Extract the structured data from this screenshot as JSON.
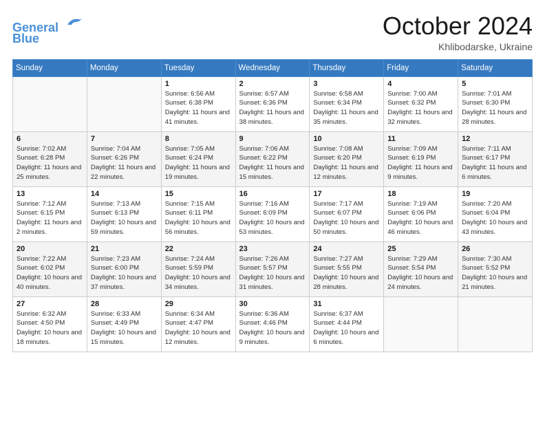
{
  "header": {
    "logo_line1": "General",
    "logo_line2": "Blue",
    "month": "October 2024",
    "location": "Khlibodarske, Ukraine"
  },
  "days_of_week": [
    "Sunday",
    "Monday",
    "Tuesday",
    "Wednesday",
    "Thursday",
    "Friday",
    "Saturday"
  ],
  "weeks": [
    [
      {
        "day": "",
        "info": ""
      },
      {
        "day": "",
        "info": ""
      },
      {
        "day": "1",
        "info": "Sunrise: 6:56 AM\nSunset: 6:38 PM\nDaylight: 11 hours and 41 minutes."
      },
      {
        "day": "2",
        "info": "Sunrise: 6:57 AM\nSunset: 6:36 PM\nDaylight: 11 hours and 38 minutes."
      },
      {
        "day": "3",
        "info": "Sunrise: 6:58 AM\nSunset: 6:34 PM\nDaylight: 11 hours and 35 minutes."
      },
      {
        "day": "4",
        "info": "Sunrise: 7:00 AM\nSunset: 6:32 PM\nDaylight: 11 hours and 32 minutes."
      },
      {
        "day": "5",
        "info": "Sunrise: 7:01 AM\nSunset: 6:30 PM\nDaylight: 11 hours and 28 minutes."
      }
    ],
    [
      {
        "day": "6",
        "info": "Sunrise: 7:02 AM\nSunset: 6:28 PM\nDaylight: 11 hours and 25 minutes."
      },
      {
        "day": "7",
        "info": "Sunrise: 7:04 AM\nSunset: 6:26 PM\nDaylight: 11 hours and 22 minutes."
      },
      {
        "day": "8",
        "info": "Sunrise: 7:05 AM\nSunset: 6:24 PM\nDaylight: 11 hours and 19 minutes."
      },
      {
        "day": "9",
        "info": "Sunrise: 7:06 AM\nSunset: 6:22 PM\nDaylight: 11 hours and 15 minutes."
      },
      {
        "day": "10",
        "info": "Sunrise: 7:08 AM\nSunset: 6:20 PM\nDaylight: 11 hours and 12 minutes."
      },
      {
        "day": "11",
        "info": "Sunrise: 7:09 AM\nSunset: 6:19 PM\nDaylight: 11 hours and 9 minutes."
      },
      {
        "day": "12",
        "info": "Sunrise: 7:11 AM\nSunset: 6:17 PM\nDaylight: 11 hours and 6 minutes."
      }
    ],
    [
      {
        "day": "13",
        "info": "Sunrise: 7:12 AM\nSunset: 6:15 PM\nDaylight: 11 hours and 2 minutes."
      },
      {
        "day": "14",
        "info": "Sunrise: 7:13 AM\nSunset: 6:13 PM\nDaylight: 10 hours and 59 minutes."
      },
      {
        "day": "15",
        "info": "Sunrise: 7:15 AM\nSunset: 6:11 PM\nDaylight: 10 hours and 56 minutes."
      },
      {
        "day": "16",
        "info": "Sunrise: 7:16 AM\nSunset: 6:09 PM\nDaylight: 10 hours and 53 minutes."
      },
      {
        "day": "17",
        "info": "Sunrise: 7:17 AM\nSunset: 6:07 PM\nDaylight: 10 hours and 50 minutes."
      },
      {
        "day": "18",
        "info": "Sunrise: 7:19 AM\nSunset: 6:06 PM\nDaylight: 10 hours and 46 minutes."
      },
      {
        "day": "19",
        "info": "Sunrise: 7:20 AM\nSunset: 6:04 PM\nDaylight: 10 hours and 43 minutes."
      }
    ],
    [
      {
        "day": "20",
        "info": "Sunrise: 7:22 AM\nSunset: 6:02 PM\nDaylight: 10 hours and 40 minutes."
      },
      {
        "day": "21",
        "info": "Sunrise: 7:23 AM\nSunset: 6:00 PM\nDaylight: 10 hours and 37 minutes."
      },
      {
        "day": "22",
        "info": "Sunrise: 7:24 AM\nSunset: 5:59 PM\nDaylight: 10 hours and 34 minutes."
      },
      {
        "day": "23",
        "info": "Sunrise: 7:26 AM\nSunset: 5:57 PM\nDaylight: 10 hours and 31 minutes."
      },
      {
        "day": "24",
        "info": "Sunrise: 7:27 AM\nSunset: 5:55 PM\nDaylight: 10 hours and 28 minutes."
      },
      {
        "day": "25",
        "info": "Sunrise: 7:29 AM\nSunset: 5:54 PM\nDaylight: 10 hours and 24 minutes."
      },
      {
        "day": "26",
        "info": "Sunrise: 7:30 AM\nSunset: 5:52 PM\nDaylight: 10 hours and 21 minutes."
      }
    ],
    [
      {
        "day": "27",
        "info": "Sunrise: 6:32 AM\nSunset: 4:50 PM\nDaylight: 10 hours and 18 minutes."
      },
      {
        "day": "28",
        "info": "Sunrise: 6:33 AM\nSunset: 4:49 PM\nDaylight: 10 hours and 15 minutes."
      },
      {
        "day": "29",
        "info": "Sunrise: 6:34 AM\nSunset: 4:47 PM\nDaylight: 10 hours and 12 minutes."
      },
      {
        "day": "30",
        "info": "Sunrise: 6:36 AM\nSunset: 4:46 PM\nDaylight: 10 hours and 9 minutes."
      },
      {
        "day": "31",
        "info": "Sunrise: 6:37 AM\nSunset: 4:44 PM\nDaylight: 10 hours and 6 minutes."
      },
      {
        "day": "",
        "info": ""
      },
      {
        "day": "",
        "info": ""
      }
    ]
  ]
}
